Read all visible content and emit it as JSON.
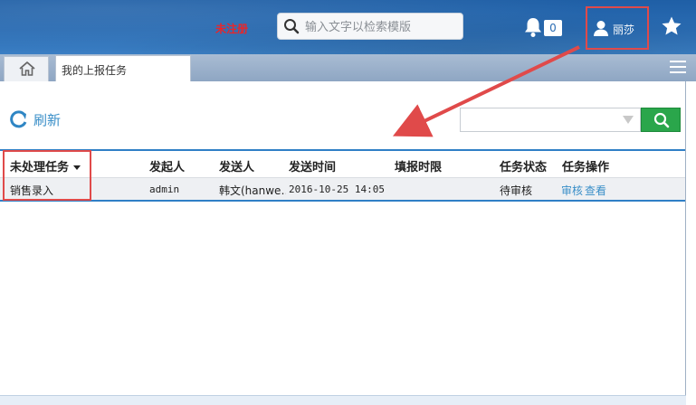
{
  "header": {
    "unregistered_label": "未注册",
    "search_placeholder": "输入文字以检索模版",
    "notification_count": "0",
    "user_name": "丽莎"
  },
  "tabs": [
    {
      "label": "我的上报任务"
    }
  ],
  "toolbar": {
    "refresh_label": "刷新",
    "filter_value": ""
  },
  "table": {
    "columns": [
      "未处理任务",
      "发起人",
      "发送人",
      "发送时间",
      "填报时限",
      "任务状态",
      "任务操作"
    ],
    "rows": [
      {
        "task": "销售录入",
        "initiator": "admin",
        "sender": "韩文(hanwe…",
        "sent_time": "2016-10-25 14:05",
        "deadline": "",
        "status": "待审核",
        "actions": [
          "审核",
          "查看"
        ]
      }
    ]
  },
  "colors": {
    "topbar": "#2a6cb3",
    "highlight": "#e04a4a",
    "link": "#3a8fc8",
    "go_button": "#2aa64b"
  }
}
